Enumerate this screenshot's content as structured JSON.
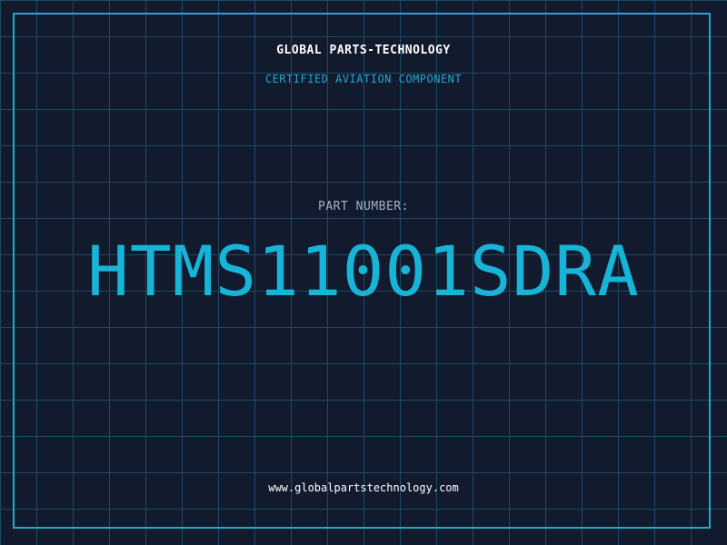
{
  "header": {
    "company": "GLOBAL PARTS-TECHNOLOGY",
    "subtitle": "CERTIFIED AVIATION COMPONENT"
  },
  "part": {
    "label": "PART NUMBER:",
    "number": "HTMS11001SDRA"
  },
  "footer": {
    "website": "www.globalpartstechnology.com"
  },
  "colors": {
    "background": "#121a2e",
    "grid": "#1d4a63",
    "accent": "#22a8d0",
    "part_number": "#18b4d8",
    "label": "#9fb3c8",
    "text": "#ffffff"
  }
}
